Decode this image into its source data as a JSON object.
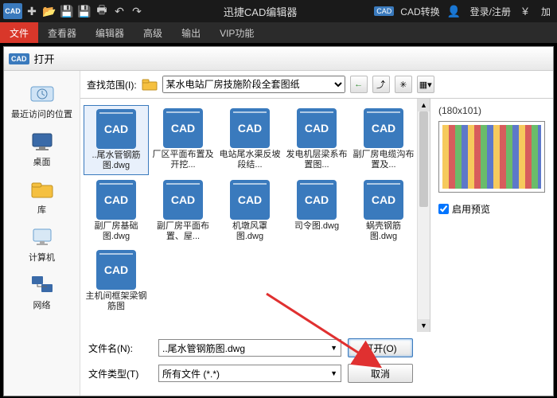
{
  "titlebar": {
    "title": "迅捷CAD编辑器",
    "cad_conv": "CAD转换",
    "login": "登录/注册",
    "currency": "¥",
    "extra": "加"
  },
  "menu": {
    "items": [
      "文件",
      "查看器",
      "编辑器",
      "高级",
      "输出",
      "VIP功能"
    ],
    "active": 0
  },
  "dialog": {
    "title": "打开",
    "look_label": "查找范围(I):",
    "look_value": "某水电站厂房技施阶段全套图纸",
    "sidebar": [
      {
        "label": "最近访问的位置",
        "icon": "recent"
      },
      {
        "label": "桌面",
        "icon": "desktop"
      },
      {
        "label": "库",
        "icon": "library"
      },
      {
        "label": "计算机",
        "icon": "computer"
      },
      {
        "label": "网络",
        "icon": "network"
      }
    ],
    "files": [
      {
        "label": "..尾水管钢筋图.dwg",
        "selected": true
      },
      {
        "label": "厂区平面布置及开挖..."
      },
      {
        "label": "电站尾水渠反坡段结..."
      },
      {
        "label": "发电机层梁系布置图..."
      },
      {
        "label": "副厂房电缆沟布置及..."
      },
      {
        "label": "副厂房基础图.dwg"
      },
      {
        "label": "副厂房平面布置、屋..."
      },
      {
        "label": "机墩风罩图.dwg"
      },
      {
        "label": "司令图.dwg"
      },
      {
        "label": "蜗壳钢筋图.dwg"
      },
      {
        "label": "主机间框架梁钢筋图"
      }
    ],
    "preview": {
      "dim": "(180x101)",
      "checkbox": "启用预览"
    },
    "filename_label": "文件名(N):",
    "filename_value": "..尾水管钢筋图.dwg",
    "filetype_label": "文件类型(T)",
    "filetype_value": "所有文件 (*.*)",
    "open_btn": "打开(O)",
    "cancel_btn": "取消"
  }
}
